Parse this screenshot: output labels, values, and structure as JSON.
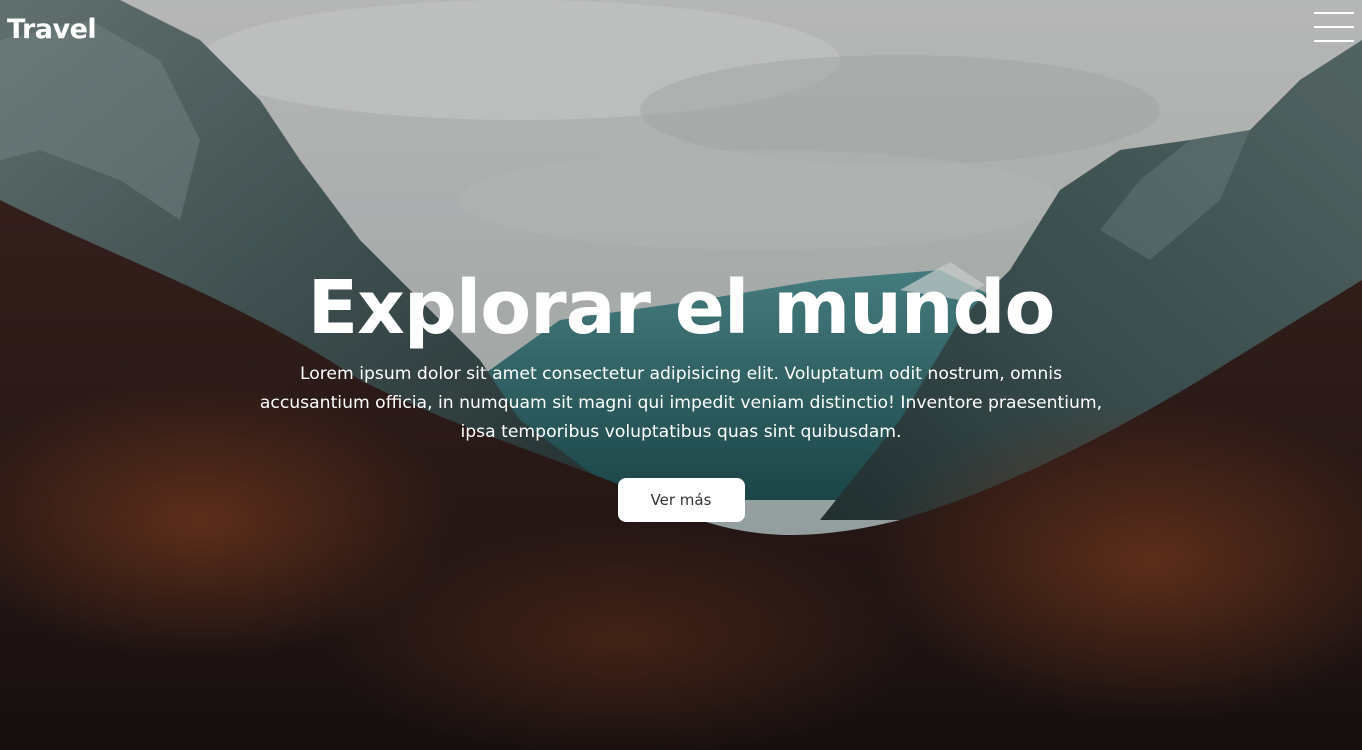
{
  "header": {
    "logo": "Travel",
    "menu_icon": "hamburger-menu-icon"
  },
  "hero": {
    "title": "Explorar el mundo",
    "description": "Lorem ipsum dolor sit amet consectetur adipisicing elit. Voluptatum odit nostrum, omnis accusantium officia, in numquam sit magni qui impedit veniam distinctio! Inventore praesentium, ipsa temporibus voluptatibus quas sint quibusdam.",
    "button_label": "Ver más"
  },
  "colors": {
    "text": "#ffffff",
    "button_bg": "#ffffff",
    "button_text": "#333333"
  }
}
